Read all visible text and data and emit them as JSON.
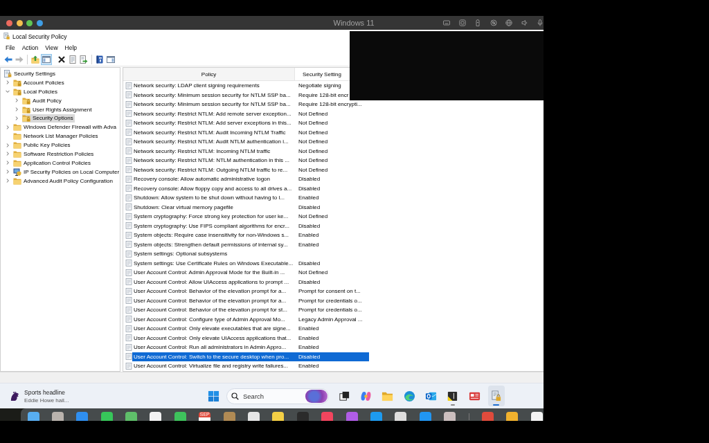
{
  "vm_window": {
    "title": "Windows 11"
  },
  "window": {
    "title": "Local Security Policy"
  },
  "menu": [
    "File",
    "Action",
    "View",
    "Help"
  ],
  "toolbar": {
    "buttons": [
      {
        "pressed": false,
        "disabled": false
      },
      {
        "pressed": false,
        "disabled": true
      },
      {
        "pressed": false,
        "disabled": false
      },
      {
        "pressed": true,
        "disabled": false
      },
      {
        "pressed": false,
        "disabled": false
      },
      {
        "pressed": false,
        "disabled": false
      },
      {
        "pressed": false,
        "disabled": false
      },
      {
        "pressed": false,
        "disabled": false
      },
      {
        "pressed": false,
        "disabled": false
      }
    ]
  },
  "tree": [
    {
      "label": "Security Settings",
      "kind": "root",
      "selected": false,
      "children": [
        {
          "label": "Account Policies",
          "kind": "locked",
          "expandable": true,
          "expanded": false,
          "selected": false
        },
        {
          "label": "Local Policies",
          "kind": "locked",
          "expandable": true,
          "expanded": true,
          "selected": false,
          "children": [
            {
              "label": "Audit Policy",
              "kind": "locked",
              "expandable": true,
              "expanded": false,
              "selected": false
            },
            {
              "label": "User Rights Assignment",
              "kind": "locked",
              "expandable": true,
              "expanded": false,
              "selected": false
            },
            {
              "label": "Security Options",
              "kind": "locked",
              "expandable": true,
              "expanded": false,
              "selected": true
            }
          ]
        },
        {
          "label": "Windows Defender Firewall with Adva",
          "kind": "folder",
          "expandable": true,
          "expanded": false,
          "selected": false
        },
        {
          "label": "Network List Manager Policies",
          "kind": "folder",
          "expandable": false,
          "selected": false
        },
        {
          "label": "Public Key Policies",
          "kind": "folder",
          "expandable": true,
          "expanded": false,
          "selected": false
        },
        {
          "label": "Software Restriction Policies",
          "kind": "folder",
          "expandable": true,
          "expanded": false,
          "selected": false
        },
        {
          "label": "Application Control Policies",
          "kind": "folder",
          "expandable": true,
          "expanded": false,
          "selected": false
        },
        {
          "label": "IP Security Policies on Local Computer",
          "kind": "computer",
          "expandable": true,
          "expanded": false,
          "selected": false
        },
        {
          "label": "Advanced Audit Policy Configuration",
          "kind": "folder",
          "expandable": true,
          "expanded": false,
          "selected": false
        }
      ]
    }
  ],
  "table": {
    "columns": [
      "Policy",
      "Security Setting"
    ],
    "rows": [
      {
        "policy": "Network security: LDAP client signing requirements",
        "setting": "Negotiate signing",
        "selected": false
      },
      {
        "policy": "Network security: Minimum session security for NTLM SSP ba...",
        "setting": "Require 128-bit encr",
        "selected": false
      },
      {
        "policy": "Network security: Minimum session security for NTLM SSP ba...",
        "setting": "Require 128-bit encrypti...",
        "selected": false
      },
      {
        "policy": "Network security: Restrict NTLM: Add remote server exception...",
        "setting": "Not Defined",
        "selected": false
      },
      {
        "policy": "Network security: Restrict NTLM: Add server exceptions in this...",
        "setting": "Not Defined",
        "selected": false
      },
      {
        "policy": "Network security: Restrict NTLM: Audit Incoming NTLM Traffic",
        "setting": "Not Defined",
        "selected": false
      },
      {
        "policy": "Network security: Restrict NTLM: Audit NTLM authentication i...",
        "setting": "Not Defined",
        "selected": false
      },
      {
        "policy": "Network security: Restrict NTLM: Incoming NTLM traffic",
        "setting": "Not Defined",
        "selected": false
      },
      {
        "policy": "Network security: Restrict NTLM: NTLM authentication in this ...",
        "setting": "Not Defined",
        "selected": false
      },
      {
        "policy": "Network security: Restrict NTLM: Outgoing NTLM traffic to re...",
        "setting": "Not Defined",
        "selected": false
      },
      {
        "policy": "Recovery console: Allow automatic administrative logon",
        "setting": "Disabled",
        "selected": false
      },
      {
        "policy": "Recovery console: Allow floppy copy and access to all drives a...",
        "setting": "Disabled",
        "selected": false
      },
      {
        "policy": "Shutdown: Allow system to be shut down without having to l...",
        "setting": "Enabled",
        "selected": false
      },
      {
        "policy": "Shutdown: Clear virtual memory pagefile",
        "setting": "Disabled",
        "selected": false
      },
      {
        "policy": "System cryptography: Force strong key protection for user ke...",
        "setting": "Not Defined",
        "selected": false
      },
      {
        "policy": "System cryptography: Use FIPS compliant algorithms for encr...",
        "setting": "Disabled",
        "selected": false
      },
      {
        "policy": "System objects: Require case insensitivity for non-Windows s...",
        "setting": "Enabled",
        "selected": false
      },
      {
        "policy": "System objects: Strengthen default permissions of internal sy...",
        "setting": "Enabled",
        "selected": false
      },
      {
        "policy": "System settings: Optional subsystems",
        "selected": false
      },
      {
        "policy": "System settings: Use Certificate Rules on Windows Executable...",
        "setting": "Disabled",
        "selected": false
      },
      {
        "policy": "User Account Control: Admin Approval Mode for the Built-in ...",
        "setting": "Not Defined",
        "selected": false
      },
      {
        "policy": "User Account Control: Allow UIAccess applications to prompt ...",
        "setting": "Disabled",
        "selected": false
      },
      {
        "policy": "User Account Control: Behavior of the elevation prompt for a...",
        "setting": "Prompt for consent on t...",
        "selected": false
      },
      {
        "policy": "User Account Control: Behavior of the elevation prompt for a...",
        "setting": "Prompt for credentials o...",
        "selected": false
      },
      {
        "policy": "User Account Control: Behavior of the elevation prompt for st...",
        "setting": "Prompt for credentials o...",
        "selected": false
      },
      {
        "policy": "User Account Control: Configure type of Admin Approval Mo...",
        "setting": "Legacy Admin Approval ...",
        "selected": false
      },
      {
        "policy": "User Account Control: Only elevate executables that are signe...",
        "setting": "Enabled",
        "selected": false
      },
      {
        "policy": "User Account Control: Only elevate UIAccess applications that...",
        "setting": "Enabled",
        "selected": false
      },
      {
        "policy": "User Account Control: Run all administrators in Admin Appro...",
        "setting": "Enabled",
        "selected": false
      },
      {
        "policy": "User Account Control: Switch to the secure desktop when pro...",
        "setting": "Disabled",
        "selected": true
      },
      {
        "policy": "User Account Control: Virtualize file and registry write failures...",
        "setting": "Enabled",
        "selected": false
      }
    ]
  },
  "taskbar": {
    "widget": {
      "title": "Sports headline",
      "subtitle": "Eddie Howe hail..."
    },
    "search": {
      "placeholder": "Search"
    },
    "apps": [
      {
        "running": false,
        "active": false
      },
      {
        "running": false,
        "active": false
      },
      {
        "running": false,
        "active": false
      },
      {
        "running": false,
        "active": false
      },
      {
        "running": false,
        "active": false
      },
      {
        "running": true,
        "active": false
      },
      {
        "running": false,
        "active": false
      },
      {
        "running": true,
        "active": true
      }
    ]
  },
  "dock": {
    "calendar_month": "SEP"
  }
}
